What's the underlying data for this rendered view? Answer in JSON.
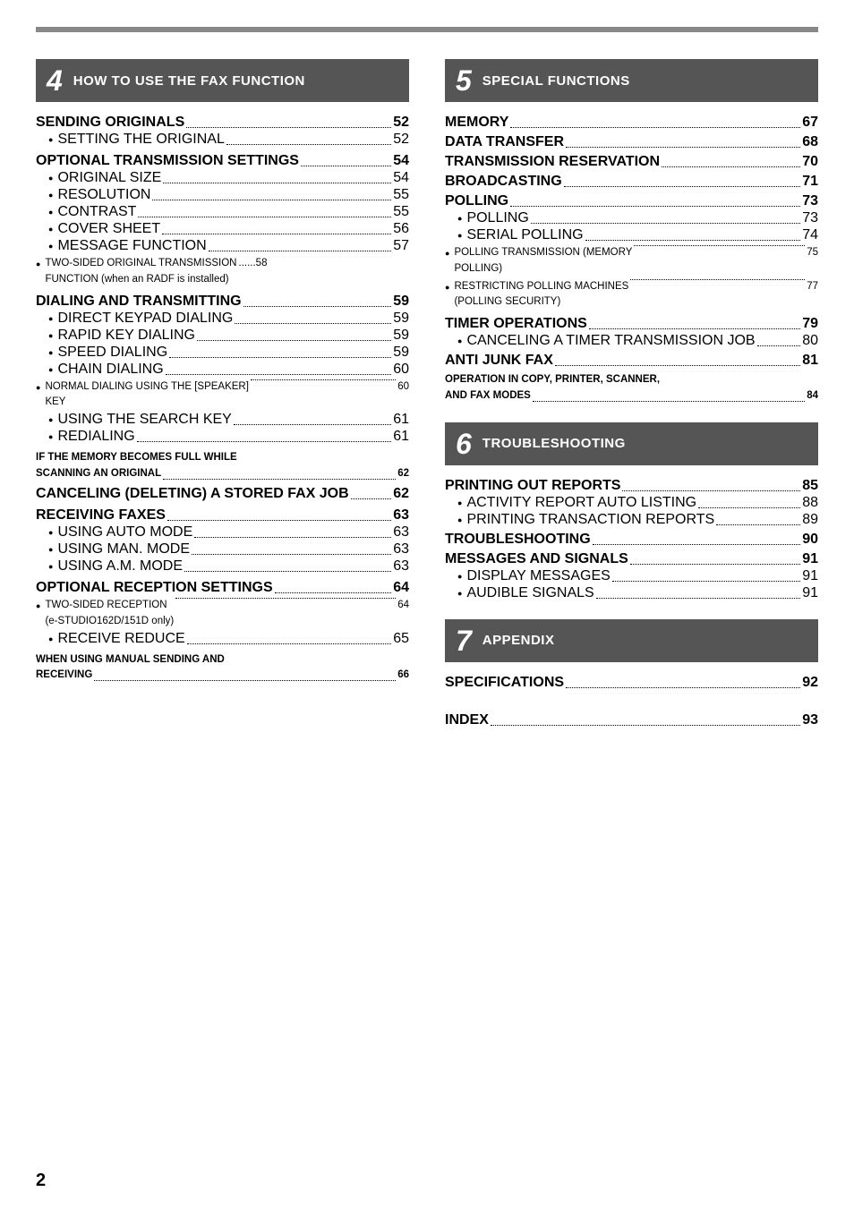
{
  "page_number": "2",
  "top_bar": true,
  "left_column": {
    "section_number": "4",
    "section_title": "HOW TO USE THE FAX FUNCTION",
    "entries": [
      {
        "type": "main",
        "label": "SENDING ORIGINALS",
        "page": "52"
      },
      {
        "type": "sub",
        "label": "SETTING THE ORIGINAL",
        "page": "52"
      },
      {
        "type": "main",
        "label": "OPTIONAL TRANSMISSION SETTINGS",
        "page": "54"
      },
      {
        "type": "sub",
        "label": "ORIGINAL SIZE",
        "page": "54"
      },
      {
        "type": "sub",
        "label": "RESOLUTION",
        "page": "55"
      },
      {
        "type": "sub",
        "label": "CONTRAST",
        "page": "55"
      },
      {
        "type": "sub",
        "label": "COVER SHEET",
        "page": "56"
      },
      {
        "type": "sub",
        "label": "MESSAGE FUNCTION",
        "page": "57"
      },
      {
        "type": "sub-multiline",
        "label": "TWO-SIDED ORIGINAL TRANSMISSION FUNCTION (when an RADF is installed)",
        "page": "58"
      },
      {
        "type": "main",
        "label": "DIALING AND TRANSMITTING",
        "page": "59"
      },
      {
        "type": "sub",
        "label": "DIRECT KEYPAD DIALING",
        "page": "59"
      },
      {
        "type": "sub",
        "label": "RAPID KEY DIALING",
        "page": "59"
      },
      {
        "type": "sub",
        "label": "SPEED DIALING",
        "page": "59"
      },
      {
        "type": "sub",
        "label": "CHAIN DIALING",
        "page": "60"
      },
      {
        "type": "sub-multiline",
        "label": "NORMAL DIALING USING THE [SPEAKER] KEY",
        "page": "60"
      },
      {
        "type": "sub",
        "label": "USING THE SEARCH KEY",
        "page": "61"
      },
      {
        "type": "sub",
        "label": "REDIALING",
        "page": "61"
      },
      {
        "type": "main-multiline",
        "label": "IF THE MEMORY BECOMES FULL WHILE SCANNING AN ORIGINAL",
        "page": "62"
      },
      {
        "type": "main",
        "label": "CANCELING (DELETING) A STORED FAX JOB",
        "page": "62"
      },
      {
        "type": "main",
        "label": "RECEIVING FAXES",
        "page": "63"
      },
      {
        "type": "sub",
        "label": "USING AUTO MODE",
        "page": "63"
      },
      {
        "type": "sub",
        "label": "USING MAN. MODE",
        "page": "63"
      },
      {
        "type": "sub",
        "label": "USING A.M. MODE",
        "page": "63"
      },
      {
        "type": "main",
        "label": "OPTIONAL RECEPTION SETTINGS",
        "page": "64"
      },
      {
        "type": "sub-multiline",
        "label": "TWO-SIDED RECEPTION (e-STUDIO162D/151D only)",
        "page": "64"
      },
      {
        "type": "sub",
        "label": "RECEIVE REDUCE",
        "page": "65"
      },
      {
        "type": "main-multiline",
        "label": "WHEN USING MANUAL SENDING AND RECEIVING",
        "page": "66"
      }
    ]
  },
  "right_column": {
    "sections": [
      {
        "section_number": "5",
        "section_title": "SPECIAL FUNCTIONS",
        "entries": [
          {
            "type": "main",
            "label": "MEMORY",
            "page": "67"
          },
          {
            "type": "main",
            "label": "DATA TRANSFER",
            "page": "68"
          },
          {
            "type": "main",
            "label": "TRANSMISSION RESERVATION",
            "page": "70"
          },
          {
            "type": "main",
            "label": "BROADCASTING",
            "page": "71"
          },
          {
            "type": "main",
            "label": "POLLING",
            "page": "73"
          },
          {
            "type": "sub",
            "label": "POLLING",
            "page": "73"
          },
          {
            "type": "sub",
            "label": "SERIAL POLLING",
            "page": "74"
          },
          {
            "type": "sub-multiline",
            "label": "POLLING TRANSMISSION (MEMORY POLLING)",
            "page": "75"
          },
          {
            "type": "sub-multiline",
            "label": "RESTRICTING POLLING MACHINES (POLLING SECURITY)",
            "page": "77"
          },
          {
            "type": "main",
            "label": "TIMER OPERATIONS",
            "page": "79"
          },
          {
            "type": "sub",
            "label": "CANCELING A TIMER TRANSMISSION JOB",
            "page": "80"
          },
          {
            "type": "main",
            "label": "ANTI JUNK FAX",
            "page": "81"
          },
          {
            "type": "main-multiline-nodots",
            "label": "OPERATION IN COPY, PRINTER, SCANNER, AND FAX MODES",
            "page": "84"
          }
        ]
      },
      {
        "section_number": "6",
        "section_title": "TROUBLESHOOTING",
        "entries": [
          {
            "type": "main",
            "label": "PRINTING OUT REPORTS",
            "page": "85"
          },
          {
            "type": "sub",
            "label": "ACTIVITY REPORT AUTO LISTING",
            "page": "88"
          },
          {
            "type": "sub",
            "label": "PRINTING TRANSACTION REPORTS",
            "page": "89"
          },
          {
            "type": "main",
            "label": "TROUBLESHOOTING",
            "page": "90"
          },
          {
            "type": "main",
            "label": "MESSAGES AND SIGNALS",
            "page": "91"
          },
          {
            "type": "sub",
            "label": "DISPLAY MESSAGES",
            "page": "91"
          },
          {
            "type": "sub",
            "label": "AUDIBLE SIGNALS",
            "page": "91"
          }
        ]
      },
      {
        "section_number": "7",
        "section_title": "APPENDIX",
        "entries": [
          {
            "type": "main",
            "label": "SPECIFICATIONS",
            "page": "92"
          },
          {
            "type": "spacer"
          },
          {
            "type": "main",
            "label": "INDEX",
            "page": "93"
          }
        ]
      }
    ]
  }
}
